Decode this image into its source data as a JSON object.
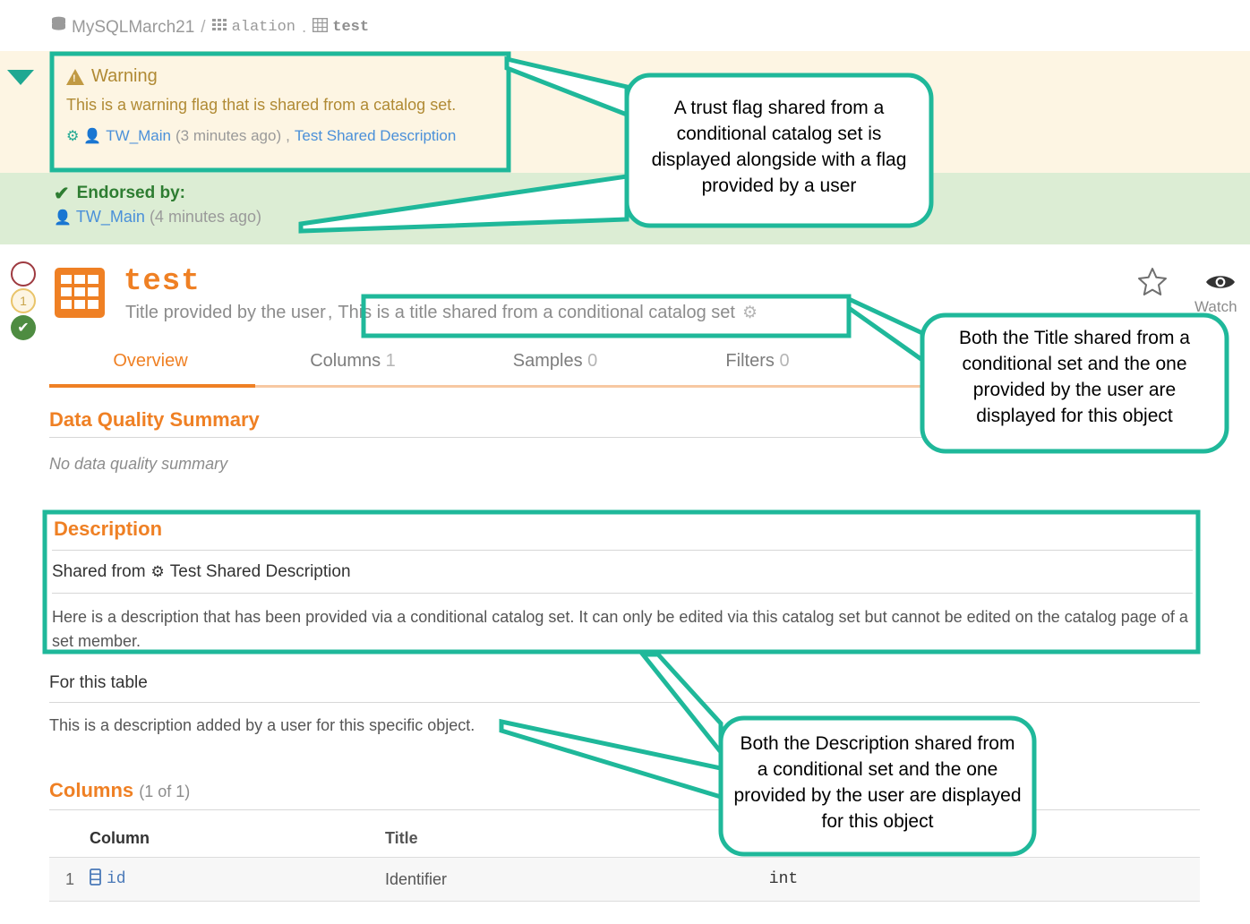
{
  "breadcrumb": {
    "db_icon": "database-icon",
    "database": "MySQLMarch21",
    "separator": "/",
    "schema_icon": "schema-icon",
    "schema": "alation",
    "dot": ".",
    "table_icon": "table-icon",
    "table": "test"
  },
  "trust": {
    "warning": {
      "icon": "warning-triangle-icon",
      "title": "Warning",
      "body": "This is a warning flag that is shared from a catalog set.",
      "gear_icon": "gear-icon",
      "person_icon": "person-icon",
      "author": "TW_Main",
      "timestamp": "(3 minutes ago)",
      "comma": ",",
      "source_link": "Test Shared Description"
    },
    "endorsement": {
      "icon": "check-icon",
      "title": "Endorsed by:",
      "person_icon": "person-icon",
      "author": "TW_Main",
      "timestamp": "(4 minutes ago)"
    },
    "collapse_icon": "caret-down-icon"
  },
  "badges": {
    "deprecation": "",
    "warning_count": "1",
    "endorsement": "✔"
  },
  "header": {
    "object_icon": "table-icon",
    "title": "test",
    "user_title": "Title provided by the user",
    "comma": ",",
    "shared_title": "This is a title shared from a conditional catalog set",
    "shared_title_gear": "gear-icon",
    "star_icon": "star-outline-icon",
    "eye_icon": "eye-icon",
    "watch_label": "Watch"
  },
  "tabs": [
    {
      "label": "Overview",
      "count": "",
      "active": true
    },
    {
      "label": "Columns",
      "count": "1",
      "active": false
    },
    {
      "label": "Samples",
      "count": "0",
      "active": false
    },
    {
      "label": "Filters",
      "count": "0",
      "active": false
    }
  ],
  "data_quality": {
    "heading": "Data Quality Summary",
    "empty_text": "No data quality summary"
  },
  "description": {
    "heading": "Description",
    "shared_from_label": "Shared from",
    "shared_from_gear": "gear-icon",
    "shared_from_link": "Test Shared Description",
    "shared_body": "Here is a description that has been provided via a conditional catalog set. It can only be edited via this catalog set but cannot be edited on the catalog page of a set member.",
    "for_this_label": "For this table",
    "for_this_body": "This is a description added by a user for this specific object."
  },
  "columns_section": {
    "heading": "Columns",
    "count": "(1 of 1)",
    "headers": [
      "",
      "Column",
      "Title",
      ""
    ],
    "rows": [
      {
        "index": "1",
        "icon": "column-icon",
        "name": "id",
        "title": "Identifier",
        "type": "int"
      }
    ]
  },
  "annotations": [
    {
      "id": "trust-flag-callout",
      "text": "A trust flag shared from a conditional catalog set is displayed alongside with a flag provided by a user"
    },
    {
      "id": "title-callout",
      "text": "Both the Title shared from a conditional set and the one provided by the user are displayed for this object"
    },
    {
      "id": "description-callout",
      "text": "Both the Description shared from a conditional set and the one provided by the user are displayed for this object"
    }
  ],
  "colors": {
    "accent_orange": "#ef8024",
    "annotation_teal": "#1fb89a",
    "warning_band": "#fdf5e3",
    "warning_text": "#b08a34",
    "endorsement_band": "#dcedd4",
    "endorsement_text": "#2e7d32",
    "link_blue": "#4a90d9"
  }
}
